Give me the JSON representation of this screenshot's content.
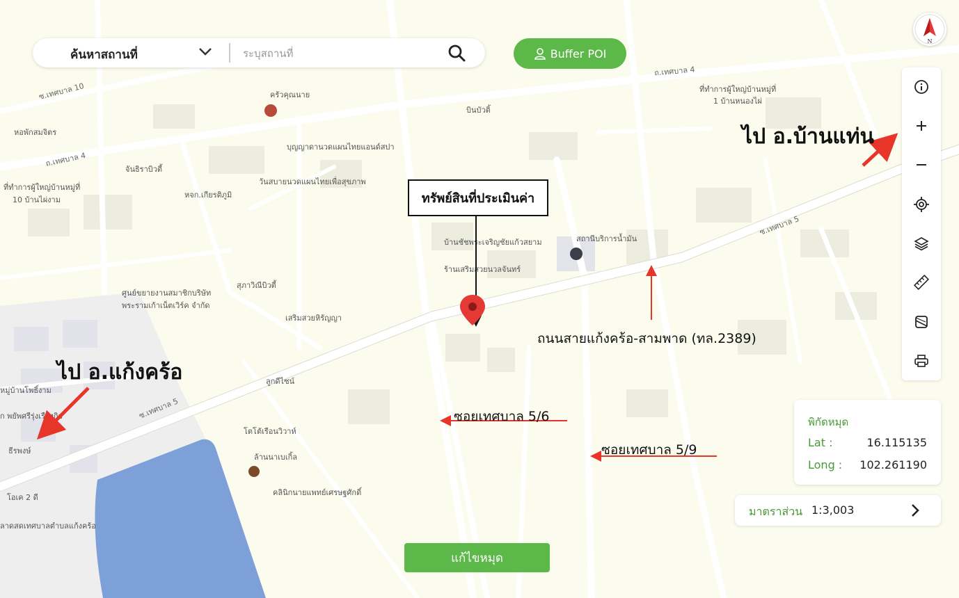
{
  "search": {
    "type_label": "ค้นหาสถานที่",
    "placeholder": "ระบุสถานที่",
    "value": ""
  },
  "buffer_button": {
    "label": "Buffer POI"
  },
  "compass": {
    "letter": "N"
  },
  "toolbar": {
    "tools": [
      "info-icon",
      "zoom-in-icon",
      "zoom-out-icon",
      "locate-icon",
      "layers-icon",
      "ruler-icon",
      "basemap-icon",
      "print-icon"
    ]
  },
  "coordinates": {
    "title": "พิกัดหมุด",
    "lat_label": "Lat :",
    "lat_value": "16.115135",
    "long_label": "Long :",
    "long_value": "102.261190"
  },
  "scale": {
    "label": "มาตราส่วน",
    "value": "1:3,003"
  },
  "edit_button": {
    "label": "แก้ไขหมุด"
  },
  "annotations": {
    "to_ban_thaen": "ไป อ.บ้านแท่น",
    "to_kaeng_khro": "ไป อ.แก้งคร้อ",
    "asset": "ทรัพย์สินที่ประเมินค่า",
    "main_road": "ถนนสายแก้งคร้อ-สามพาด (ทล.2389)",
    "soi_5_6": "ซอยเทศบาล 5/6",
    "soi_5_9": "ซอยเทศบาล 5/9"
  },
  "map_labels": {
    "roads": [
      "ซ.เทศบาล 10",
      "ถ.เทศบาล 4",
      "ถ.เทศบาล 4",
      "ซ.เทศบาล 5",
      "ซ.เทศบาล 5"
    ],
    "pois": [
      "ครัวคุณนาย",
      "บินบัวติ้",
      "ที่ทำการผู้ใหญ่บ้านหมู่ที่",
      "1 บ้านหนองไผ่",
      "หอพักสมจิตร",
      "บุญญาดานวดแผนไทยแอนด์สปา",
      "จันธิราบิวตี้",
      "วันสบายนวดแผนไทยเพื่อสุขภาพ",
      "ที่ทำการผู้ใหญ่บ้านหมู่ที่",
      "10 บ้านไผ่งาม",
      "หจก.เกียรติภูมิ",
      "บ้านชัชพระเจริญชัยแก้วสยาม",
      "ร้านเสริมสวยนวลจันทร์",
      "สถานีบริการน้ำมัน",
      "สุภาวิณีบิวตี้",
      "ศูนย์ขยายงานสมาชิกบริษัท",
      "พระรามเก้าเน็ตเวิร์ค จำกัด",
      "เสริมสวยหิรัญญา",
      "ลูกดีไซน์",
      "โตโต้เรือนวิวาห์",
      "ล้านนาเบเกิ้ล",
      "คลินิกนายแพทย์เศรษฐศักดิ์",
      "หมู่บ้านโพธิ์งาม",
      "ก พยัพศรีรุ่งเรืองกิจ",
      "ธีรพงษ์",
      "โอเค 2 ดี",
      "ลาดสดเทศบาลตำบลแก้งคร้อ"
    ]
  },
  "colors": {
    "accent_green": "#5cb848",
    "label_green": "#4a9a34",
    "annotation_red": "#e8352a",
    "pin_red": "#e53935",
    "water": "#7da0d9",
    "land": "#fbfbef"
  }
}
